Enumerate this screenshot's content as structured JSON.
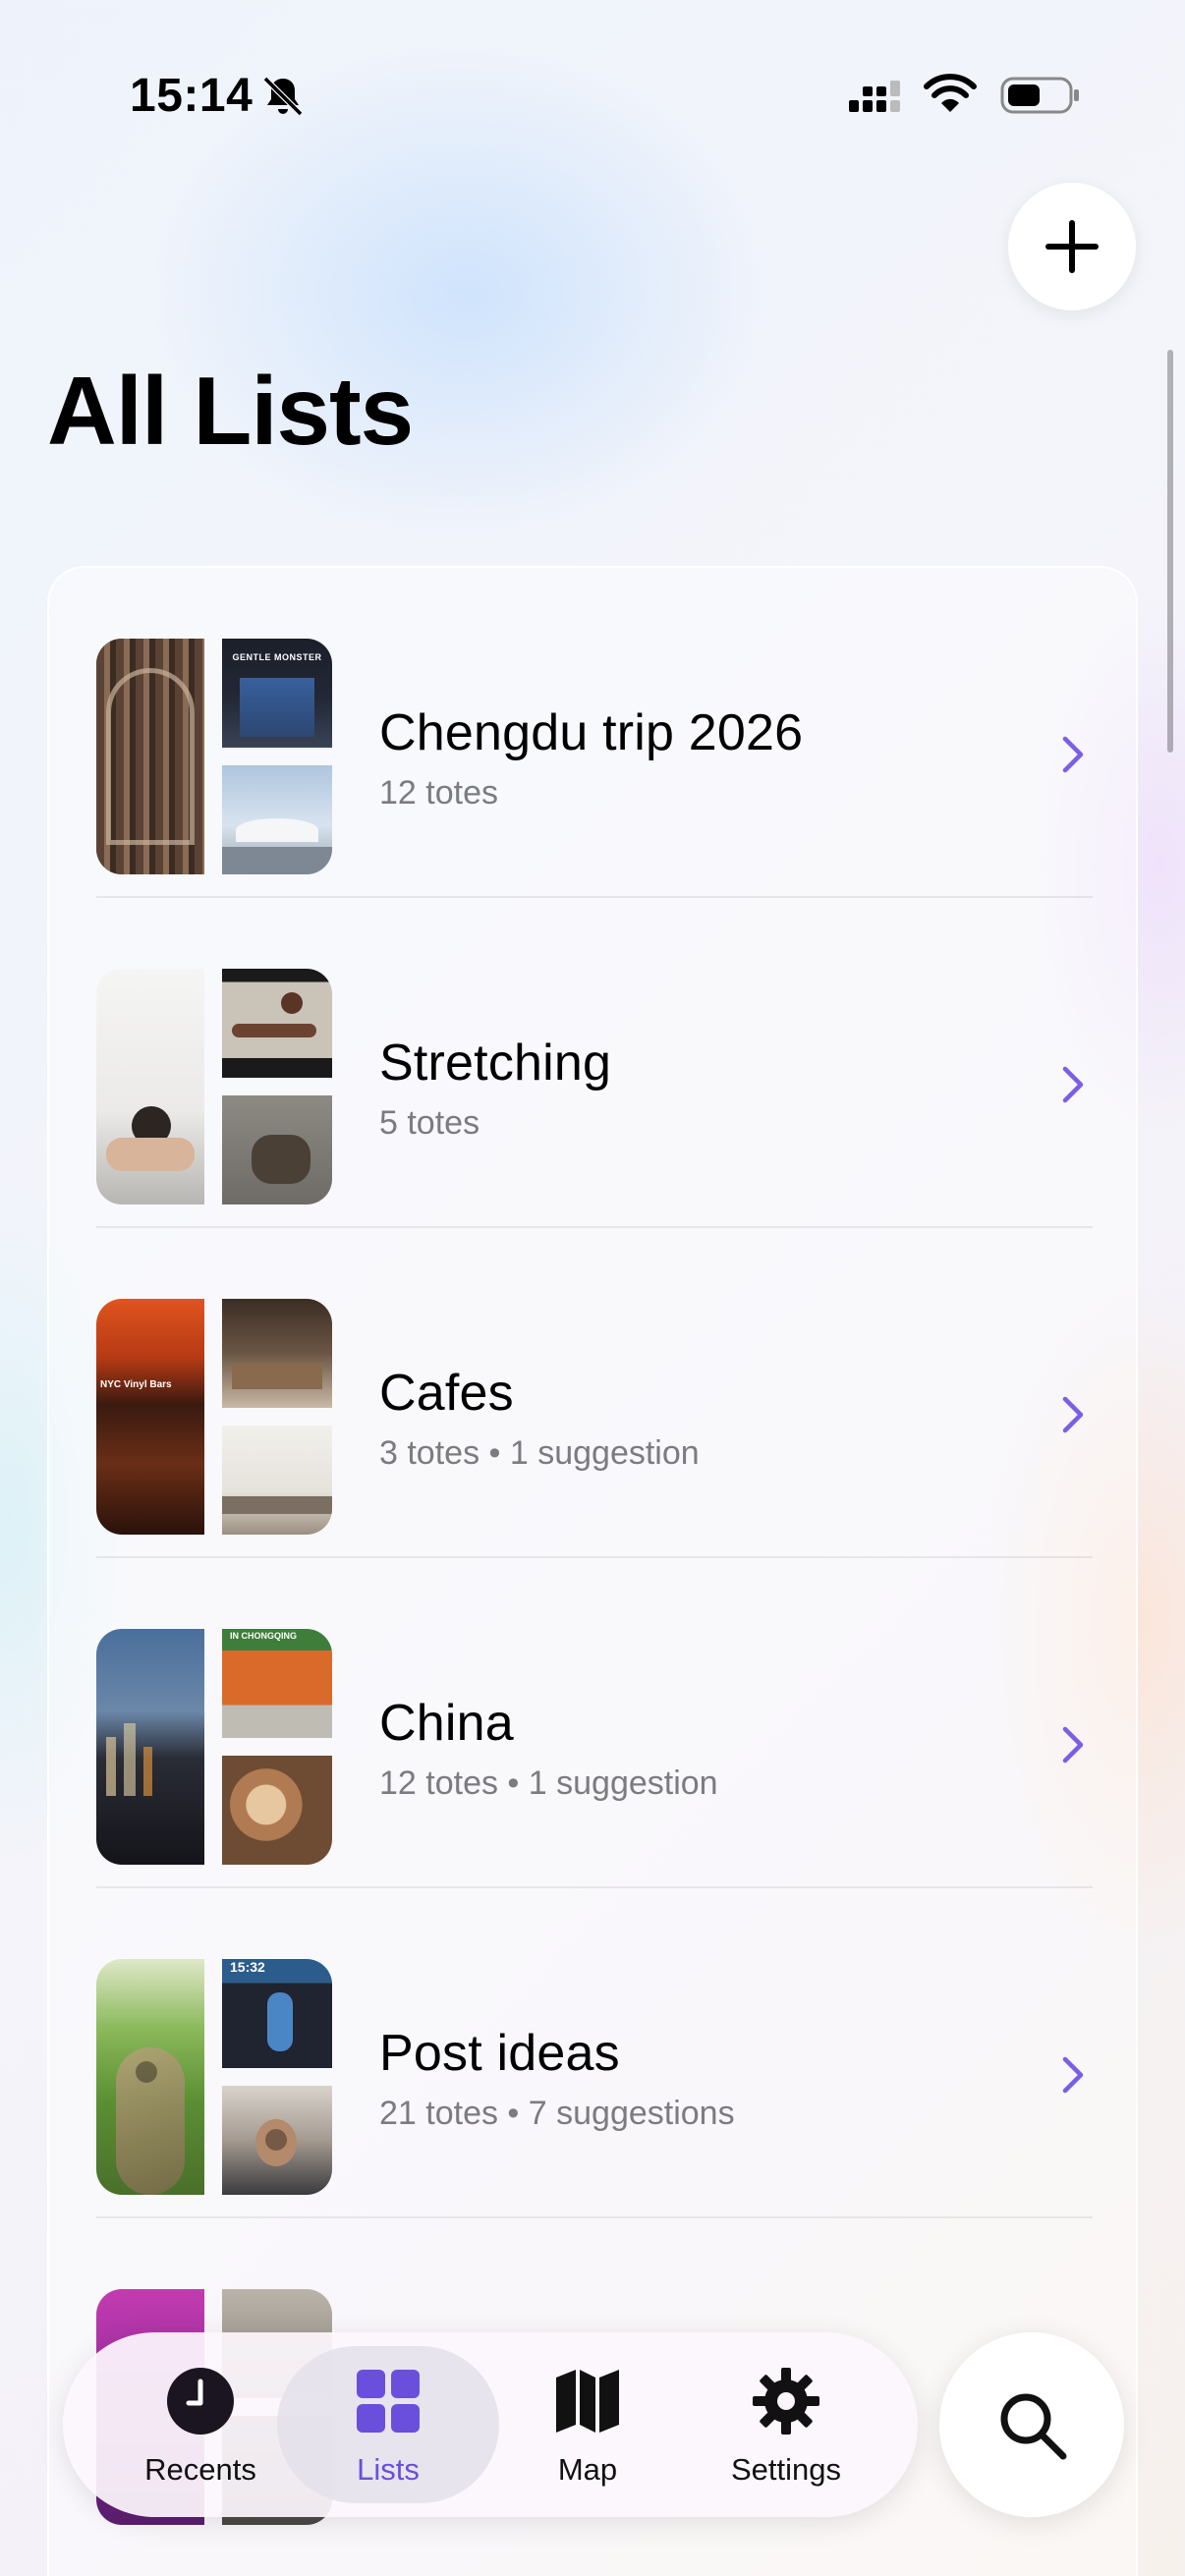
{
  "status_bar": {
    "time": "15:14"
  },
  "header": {
    "title": "All Lists"
  },
  "lists": [
    {
      "title": "Chengdu trip 2026",
      "subtitle": "12 totes",
      "thumb_overlay": "GENTLE MONSTER"
    },
    {
      "title": "Stretching",
      "subtitle": "5 totes",
      "thumb_overlay": ""
    },
    {
      "title": "Cafes",
      "subtitle": "3 totes • 1 suggestion",
      "thumb_overlay": "NYC Vinyl Bars"
    },
    {
      "title": "China",
      "subtitle": "12 totes • 1 suggestion",
      "thumb_overlay": "IN CHONGQING"
    },
    {
      "title": "Post ideas",
      "subtitle": "21 totes • 7 suggestions",
      "thumb_overlay": "15:32"
    }
  ],
  "tab_bar": {
    "tabs": [
      {
        "label": "Recents",
        "icon": "clock-icon"
      },
      {
        "label": "Lists",
        "icon": "grid-icon",
        "active": true
      },
      {
        "label": "Map",
        "icon": "map-icon"
      },
      {
        "label": "Settings",
        "icon": "gear-icon"
      }
    ]
  },
  "colors": {
    "accent": "#6a4fdc",
    "chevron": "#7a5ee6",
    "subtitle": "#7c7b81"
  }
}
